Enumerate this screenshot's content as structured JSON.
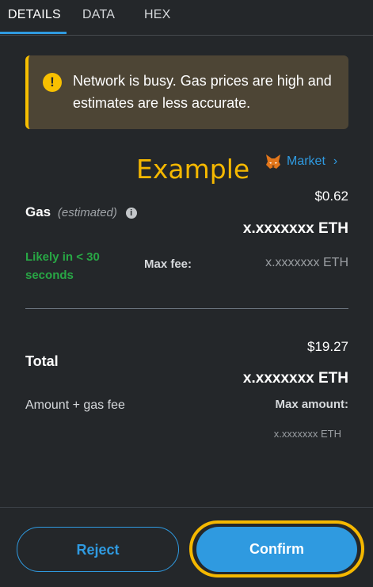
{
  "tabs": [
    {
      "label": "DETAILS",
      "active": true
    },
    {
      "label": "DATA",
      "active": false
    },
    {
      "label": "HEX",
      "active": false
    }
  ],
  "warning": {
    "icon": "exclamation-circle-icon",
    "text": "Network is busy. Gas prices are high and estimates are less accurate."
  },
  "overlay_text": "Example",
  "market": {
    "icon": "metamask-fox-icon",
    "label": "Market",
    "chevron": "›"
  },
  "gas": {
    "label": "Gas",
    "estimated": "(estimated)",
    "usd": "$0.62",
    "eth": "x.xxxxxxx ETH",
    "likely": "Likely in < 30 seconds",
    "max_fee_label": "Max fee:",
    "max_fee_value": "x.xxxxxxx ETH"
  },
  "total": {
    "label": "Total",
    "usd": "$19.27",
    "eth": "x.xxxxxxx ETH",
    "subtitle": "Amount + gas fee",
    "max_amount_label": "Max amount:",
    "max_amount_value": "x.xxxxxxx ETH"
  },
  "buttons": {
    "reject": "Reject",
    "confirm": "Confirm"
  },
  "colors": {
    "background": "#24272a",
    "accent": "#2f9ae0",
    "warning": "#f8c000",
    "success": "#28a745",
    "highlight": "#f5b800"
  }
}
